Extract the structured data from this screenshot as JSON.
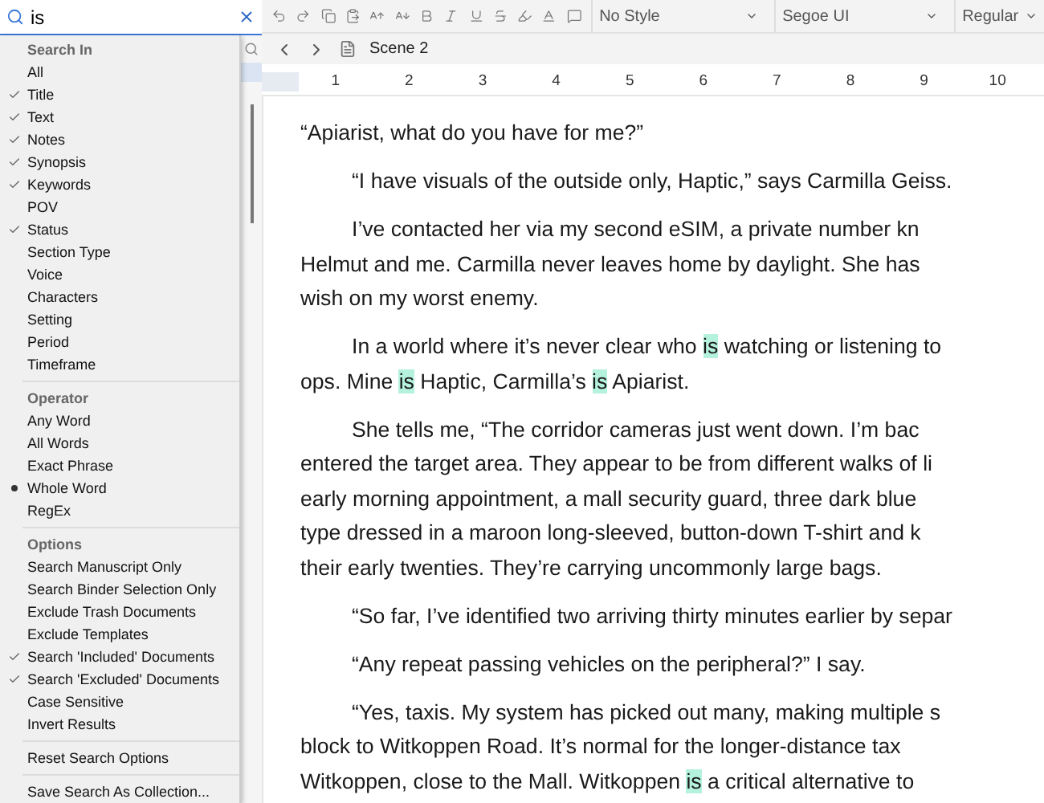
{
  "search": {
    "value": "is"
  },
  "menu": {
    "sections": [
      {
        "header": "Search In",
        "items": [
          {
            "label": "All",
            "checked": false,
            "kind": "check"
          },
          {
            "label": "Title",
            "checked": true,
            "kind": "check"
          },
          {
            "label": "Text",
            "checked": true,
            "kind": "check"
          },
          {
            "label": "Notes",
            "checked": true,
            "kind": "check"
          },
          {
            "label": "Synopsis",
            "checked": true,
            "kind": "check"
          },
          {
            "label": "Keywords",
            "checked": true,
            "kind": "check"
          },
          {
            "label": "POV",
            "checked": false,
            "kind": "check"
          },
          {
            "label": "Status",
            "checked": true,
            "kind": "check"
          },
          {
            "label": "Section Type",
            "checked": false,
            "kind": "check"
          },
          {
            "label": "Voice",
            "checked": false,
            "kind": "check"
          },
          {
            "label": "Characters",
            "checked": false,
            "kind": "check"
          },
          {
            "label": "Setting",
            "checked": false,
            "kind": "check"
          },
          {
            "label": "Period",
            "checked": false,
            "kind": "check"
          },
          {
            "label": "Timeframe",
            "checked": false,
            "kind": "check"
          }
        ]
      },
      {
        "header": "Operator",
        "items": [
          {
            "label": "Any Word",
            "selected": false,
            "kind": "radio"
          },
          {
            "label": "All Words",
            "selected": false,
            "kind": "radio"
          },
          {
            "label": "Exact Phrase",
            "selected": false,
            "kind": "radio"
          },
          {
            "label": "Whole Word",
            "selected": true,
            "kind": "radio"
          },
          {
            "label": "RegEx",
            "selected": false,
            "kind": "radio"
          }
        ]
      },
      {
        "header": "Options",
        "items": [
          {
            "label": "Search Manuscript Only",
            "checked": false,
            "kind": "check"
          },
          {
            "label": "Search Binder Selection Only",
            "checked": false,
            "kind": "check"
          },
          {
            "label": "Exclude Trash Documents",
            "checked": false,
            "kind": "check"
          },
          {
            "label": "Exclude Templates",
            "checked": false,
            "kind": "check"
          },
          {
            "label": "Search 'Included' Documents",
            "checked": true,
            "kind": "check"
          },
          {
            "label": "Search 'Excluded' Documents",
            "checked": true,
            "kind": "check"
          },
          {
            "label": "Case Sensitive",
            "checked": false,
            "kind": "check"
          },
          {
            "label": "Invert Results",
            "checked": false,
            "kind": "check"
          }
        ]
      }
    ],
    "actions": [
      "Reset Search Options",
      "Save Search As Collection..."
    ]
  },
  "toolbar": {
    "style": "No Style",
    "font": "Segoe UI",
    "weight": "Regular"
  },
  "breadcrumb": {
    "document": "Scene 2"
  },
  "ruler": [
    "1",
    "2",
    "3",
    "4",
    "5",
    "6",
    "7",
    "8",
    "9",
    "10"
  ],
  "document": {
    "paragraphs": [
      {
        "indent": false,
        "lines": [
          [
            {
              "text": "“Apiarist, what do you have for me?”",
              "match": false
            }
          ]
        ]
      },
      {
        "indent": true,
        "lines": [
          [
            {
              "text": "“I have visuals of the outside only, Haptic,” says Carmilla Geiss.",
              "match": false
            }
          ]
        ]
      },
      {
        "indent": true,
        "lines": [
          [
            {
              "text": "I’ve contacted her via my second eSIM, a private number kn",
              "match": false
            }
          ],
          [
            {
              "text": "Helmut and me. Carmilla never leaves home by daylight. She has",
              "match": false
            }
          ],
          [
            {
              "text": "wish on my worst enemy.",
              "match": false
            }
          ]
        ]
      },
      {
        "indent": true,
        "lines": [
          [
            {
              "text": "In a world where it’s never clear who ",
              "match": false
            },
            {
              "text": "is",
              "match": true
            },
            {
              "text": " watching or listening to",
              "match": false
            }
          ],
          [
            {
              "text": "ops. Mine ",
              "match": false
            },
            {
              "text": "is",
              "match": true
            },
            {
              "text": " Haptic, Carmilla’s ",
              "match": false
            },
            {
              "text": "is",
              "match": true
            },
            {
              "text": " Apiarist.",
              "match": false
            }
          ]
        ]
      },
      {
        "indent": true,
        "lines": [
          [
            {
              "text": "She tells me, “The corridor cameras just went down. I’m bac",
              "match": false
            }
          ],
          [
            {
              "text": "entered the target area. They appear to be from different walks of li",
              "match": false
            }
          ],
          [
            {
              "text": "early morning appointment, a mall security guard, three dark blue",
              "match": false
            }
          ],
          [
            {
              "text": "type dressed in a maroon long-sleeved, button-down T-shirt and k",
              "match": false
            }
          ],
          [
            {
              "text": "their early twenties. They’re carrying uncommonly large bags.",
              "match": false
            }
          ]
        ]
      },
      {
        "indent": true,
        "lines": [
          [
            {
              "text": "“So far, I’ve identified two arriving thirty minutes earlier by separ",
              "match": false
            }
          ]
        ]
      },
      {
        "indent": true,
        "lines": [
          [
            {
              "text": "“Any repeat passing vehicles on the peripheral?” I say.",
              "match": false
            }
          ]
        ]
      },
      {
        "indent": true,
        "lines": [
          [
            {
              "text": "“Yes, taxis. My system has picked out many, making multiple s",
              "match": false
            }
          ],
          [
            {
              "text": "block to Witkoppen Road. It’s normal for the longer-distance tax",
              "match": false
            }
          ],
          [
            {
              "text": "Witkoppen, close to the Mall. Witkoppen ",
              "match": false
            },
            {
              "text": "is",
              "match": true
            },
            {
              "text": " a critical alternative to",
              "match": false
            }
          ]
        ]
      }
    ]
  }
}
